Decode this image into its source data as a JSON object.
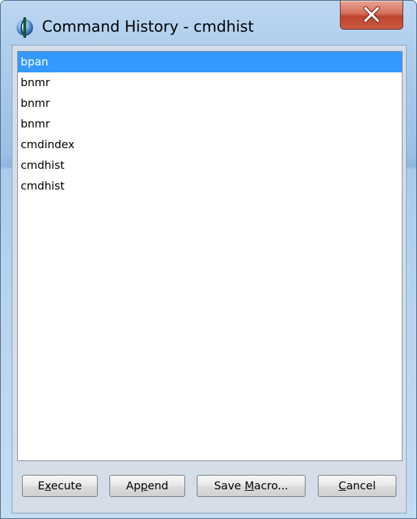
{
  "window": {
    "title": "Command History - cmdhist"
  },
  "history": {
    "items": [
      "bpan",
      "bnmr",
      "bnmr",
      "bnmr",
      "cmdindex",
      "cmdhist",
      "cmdhist"
    ],
    "selected_index": 0
  },
  "buttons": {
    "execute": {
      "pre": "E",
      "mnemonic": "x",
      "post": "ecute"
    },
    "append": {
      "pre": "Ap",
      "mnemonic": "p",
      "post": "end"
    },
    "save_macro": {
      "pre": "Save ",
      "mnemonic": "M",
      "post": "acro..."
    },
    "cancel": {
      "pre": "",
      "mnemonic": "C",
      "post": "ancel"
    }
  },
  "colors": {
    "selection": "#3399ff",
    "close_button": "#c0432c"
  },
  "icons": {
    "app": "app-globe-icon",
    "close": "close-icon"
  }
}
